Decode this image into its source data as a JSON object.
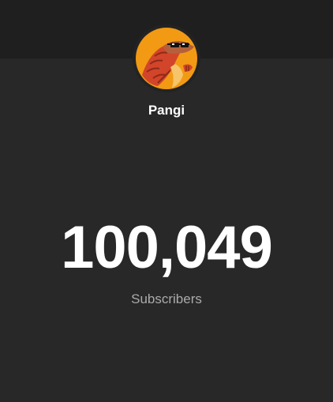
{
  "channel": {
    "name": "Pangi",
    "avatar_icon": "pangolin-with-sunglasses-avatar"
  },
  "subscribers": {
    "count": "100,049",
    "label": "Subscribers"
  },
  "colors": {
    "background": "#282828",
    "top_band": "#1f1f1f",
    "text_primary": "#ffffff",
    "text_secondary": "#aaaaaa",
    "avatar_orange": "#f29a14",
    "avatar_red": "#d2452a"
  }
}
